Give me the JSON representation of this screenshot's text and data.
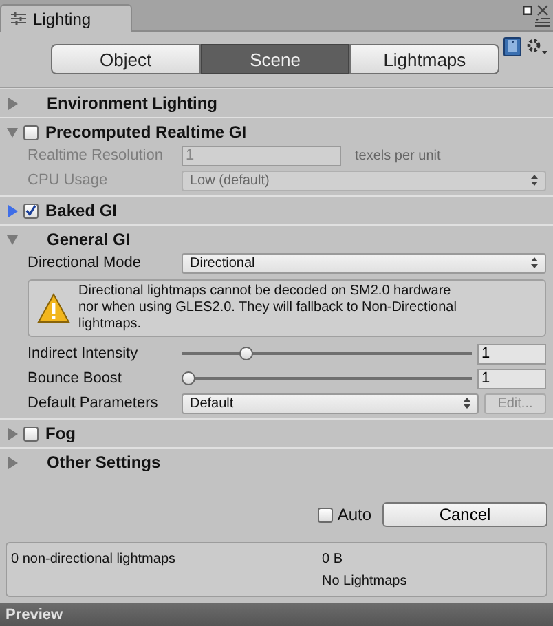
{
  "window": {
    "tab": "Lighting"
  },
  "mode_tabs": [
    {
      "label": "Object",
      "selected": false
    },
    {
      "label": "Scene",
      "selected": true
    },
    {
      "label": "Lightmaps",
      "selected": false
    }
  ],
  "sections": [
    {
      "title": "Environment Lighting",
      "expanded": false,
      "selected": false
    },
    {
      "title": "Precomputed Realtime GI",
      "expanded": true,
      "selected": false,
      "checked": false,
      "rows": [
        {
          "kind": "field",
          "label": "Realtime Resolution",
          "value": "1",
          "suffix": "texels per unit",
          "disabled": true
        },
        {
          "kind": "dropdown",
          "label": "CPU Usage",
          "value": "Low (default)",
          "disabled": true
        }
      ]
    },
    {
      "title": "Baked GI",
      "expanded": false,
      "selected": true,
      "checked": true
    },
    {
      "title": "General GI",
      "expanded": true,
      "selected": false,
      "rows": [
        {
          "kind": "dropdown",
          "label": "Directional Mode",
          "value": "Directional",
          "disabled": false
        },
        {
          "kind": "helpbox",
          "text": "Directional lightmaps cannot be decoded on SM2.0 hardware nor when using GLES2.0. They will fallback to Non-Directional lightmaps."
        },
        {
          "kind": "slider",
          "label": "Indirect Intensity",
          "level": 0.21,
          "value": "1",
          "disabled": false
        },
        {
          "kind": "slider",
          "label": "Bounce Boost",
          "level": 0,
          "value": "1",
          "disabled": false
        },
        {
          "kind": "dropdown_button",
          "label": "Default Parameters",
          "value": "Default",
          "button": "Edit...",
          "button_disabled": true,
          "disabled": false
        }
      ]
    },
    {
      "title": "Fog",
      "expanded": false,
      "selected": false,
      "checked": false
    },
    {
      "title": "Other Settings",
      "expanded": false,
      "selected": false
    }
  ],
  "auto": {
    "label": "Auto",
    "checked": false
  },
  "cancel_button": "Cancel",
  "stats": {
    "left": "0 non-directional lightmaps",
    "right": [
      "0 B",
      "No Lightmaps"
    ]
  },
  "preview": "Preview"
}
